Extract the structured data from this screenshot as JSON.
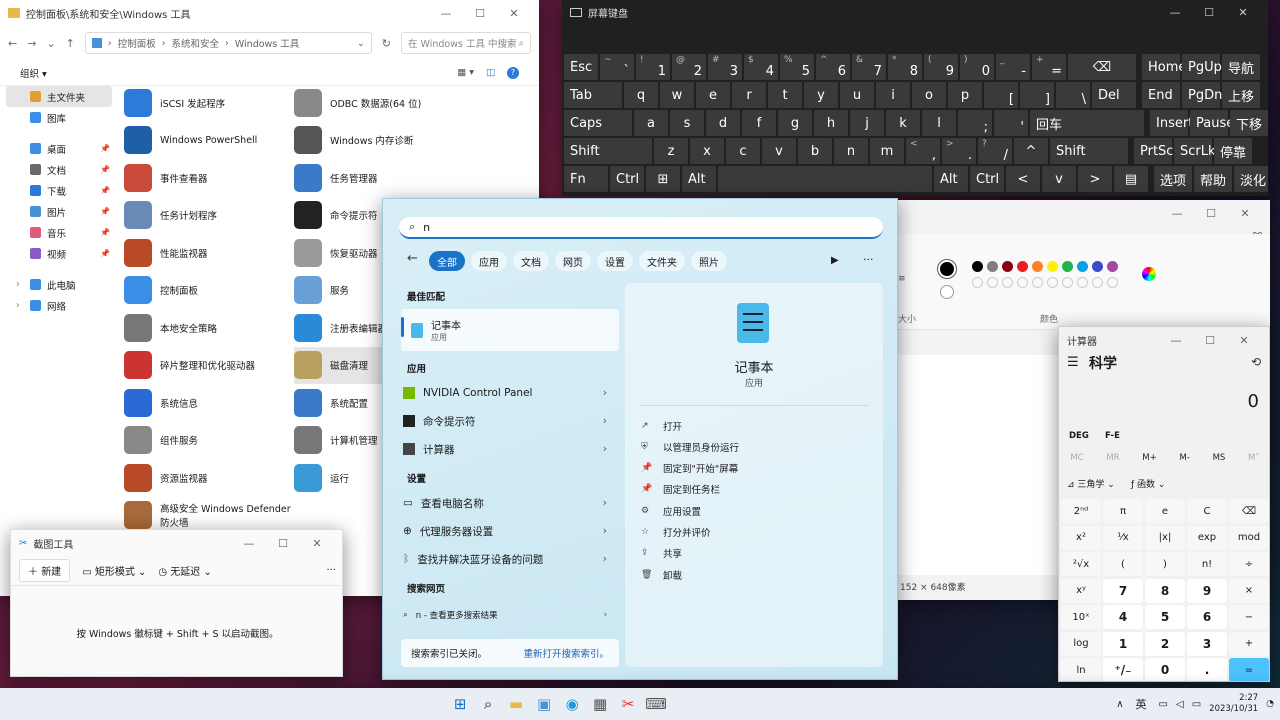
{
  "explorer": {
    "title": "控制面板\\系统和安全\\Windows 工具",
    "breadcrumb": [
      "控制面板",
      "系统和安全",
      "Windows 工具"
    ],
    "search_placeholder": "在 Windows 工具 中搜索",
    "organize": "组织",
    "nav": [
      {
        "label": "主文件夹",
        "pin": false,
        "sel": true,
        "color": "#e0a030"
      },
      {
        "label": "图库",
        "pin": false,
        "color": "#3a8ee6"
      },
      {
        "label": "桌面",
        "pin": true,
        "color": "#3a8ee6"
      },
      {
        "label": "文档",
        "pin": true,
        "color": "#6a6a6a"
      },
      {
        "label": "下载",
        "pin": true,
        "color": "#2a7ad6"
      },
      {
        "label": "图片",
        "pin": true,
        "color": "#4a90d9"
      },
      {
        "label": "音乐",
        "pin": true,
        "color": "#e05a7a"
      },
      {
        "label": "视频",
        "pin": true,
        "color": "#8a5ac8"
      },
      {
        "label": "此电脑",
        "pin": false,
        "color": "#3a8ee6"
      },
      {
        "label": "网络",
        "pin": false,
        "color": "#3a8ee6"
      }
    ],
    "files_left": [
      "iSCSI 发起程序",
      "Windows PowerShell",
      "事件查看器",
      "任务计划程序",
      "性能监视器",
      "控制面板",
      "本地安全策略",
      "碎片整理和优化驱动器",
      "系统信息",
      "组件服务",
      "资源监视器",
      "高级安全 Windows Defender 防火墙"
    ],
    "files_right": [
      "ODBC 数据源(64 位)",
      "Windows 内存诊断",
      "任务管理器",
      "命令提示符",
      "恢复驱动器",
      "服务",
      "注册表编辑器",
      "磁盘清理",
      "系统配置",
      "计算机管理",
      "运行"
    ]
  },
  "osk": {
    "title": "屏幕键盘",
    "rows": [
      [
        [
          "Esc",
          ""
        ],
        [
          "~",
          "`"
        ],
        [
          "!",
          "1"
        ],
        [
          "@",
          "2"
        ],
        [
          "#",
          "3"
        ],
        [
          "$",
          "4"
        ],
        [
          "%",
          "5"
        ],
        [
          "^",
          "6"
        ],
        [
          "&",
          "7"
        ],
        [
          "*",
          "8"
        ],
        [
          "(",
          "9"
        ],
        [
          ")",
          "0"
        ],
        [
          "_",
          "-"
        ],
        [
          "+",
          "="
        ],
        [
          "⌫",
          ""
        ],
        [
          "Home",
          ""
        ],
        [
          "PgUp",
          ""
        ],
        [
          "导航",
          ""
        ]
      ],
      [
        [
          "Tab",
          ""
        ],
        [
          "q",
          ""
        ],
        [
          "w",
          ""
        ],
        [
          "e",
          ""
        ],
        [
          "r",
          ""
        ],
        [
          "t",
          ""
        ],
        [
          "y",
          ""
        ],
        [
          "u",
          ""
        ],
        [
          "i",
          ""
        ],
        [
          "o",
          ""
        ],
        [
          "p",
          ""
        ],
        [
          "",
          "["
        ],
        [
          "",
          "]"
        ],
        [
          "",
          "\\"
        ],
        [
          "Del",
          ""
        ],
        [
          "End",
          ""
        ],
        [
          "PgDn",
          ""
        ],
        [
          "上移",
          ""
        ]
      ],
      [
        [
          "Caps",
          ""
        ],
        [
          "a",
          ""
        ],
        [
          "s",
          ""
        ],
        [
          "d",
          ""
        ],
        [
          "f",
          ""
        ],
        [
          "g",
          ""
        ],
        [
          "h",
          ""
        ],
        [
          "j",
          ""
        ],
        [
          "k",
          ""
        ],
        [
          "l",
          ""
        ],
        [
          "",
          ";"
        ],
        [
          "",
          "'"
        ],
        [
          "回车",
          ""
        ],
        [
          "Insert",
          ""
        ],
        [
          "Pause",
          ""
        ],
        [
          "下移",
          ""
        ]
      ],
      [
        [
          "Shift",
          ""
        ],
        [
          "z",
          ""
        ],
        [
          "x",
          ""
        ],
        [
          "c",
          ""
        ],
        [
          "v",
          ""
        ],
        [
          "b",
          ""
        ],
        [
          "n",
          ""
        ],
        [
          "m",
          ""
        ],
        [
          "<",
          ","
        ],
        [
          ">",
          "."
        ],
        [
          "?",
          "/"
        ],
        [
          "^",
          ""
        ],
        [
          "Shift",
          ""
        ],
        [
          "PrtScn",
          ""
        ],
        [
          "ScrLk",
          ""
        ],
        [
          "停靠",
          ""
        ]
      ],
      [
        [
          "Fn",
          ""
        ],
        [
          "Ctrl",
          ""
        ],
        [
          "⊞",
          ""
        ],
        [
          "Alt",
          ""
        ],
        [
          "",
          ""
        ],
        [
          "Alt",
          ""
        ],
        [
          "Ctrl",
          ""
        ],
        [
          "<",
          ""
        ],
        [
          "v",
          ""
        ],
        [
          ">",
          ""
        ],
        [
          "▤",
          ""
        ],
        [
          "选项",
          ""
        ],
        [
          "帮助",
          ""
        ],
        [
          "淡化",
          ""
        ]
      ]
    ]
  },
  "paint": {
    "size_label": "大小",
    "colors_label": "颜色",
    "canvas_size": "152 × 648像素",
    "colors": [
      "#000000",
      "#7f7f7f",
      "#880015",
      "#ed1c24",
      "#ff7f27",
      "#fff200",
      "#22b14c",
      "#00a2e8",
      "#3f48cc",
      "#a349a4",
      "#ffffff",
      "#c3c3c3",
      "#b97a57",
      "#ffaec9",
      "#ffc90e",
      "#efe4b0",
      "#b5e61d",
      "#99d9ea",
      "#7092be",
      "#c8bfe7"
    ]
  },
  "calc": {
    "title": "计算器",
    "mode": "科学",
    "display": "0",
    "deg": "DEG",
    "fe": "F-E",
    "mem": [
      "MC",
      "MR",
      "M+",
      "M-",
      "MS",
      "M˅"
    ],
    "trig": "三角学",
    "func": "函数",
    "keys": [
      [
        "2ⁿᵈ",
        "π",
        "e",
        "C",
        "⌫"
      ],
      [
        "x²",
        "¹⁄x",
        "|x|",
        "exp",
        "mod"
      ],
      [
        "²√x",
        "(",
        ")",
        "n!",
        "÷"
      ],
      [
        "xʸ",
        "7",
        "8",
        "9",
        "×"
      ],
      [
        "10ˣ",
        "4",
        "5",
        "6",
        "−"
      ],
      [
        "log",
        "1",
        "2",
        "3",
        "+"
      ],
      [
        "ln",
        "⁺/₋",
        "0",
        ".",
        "="
      ]
    ]
  },
  "snip": {
    "title": "截图工具",
    "new": "新建",
    "mode": "矩形模式",
    "delay": "无延迟",
    "hint": "按 Windows 徽标键 + Shift + S 以启动截图。"
  },
  "search": {
    "query": "n",
    "tabs": [
      "全部",
      "应用",
      "文档",
      "网页",
      "设置",
      "文件夹",
      "照片"
    ],
    "best_match_header": "最佳匹配",
    "best_match": {
      "name": "记事本",
      "type": "应用"
    },
    "apps_header": "应用",
    "apps": [
      "NVIDIA Control Panel",
      "命令提示符",
      "计算器"
    ],
    "settings_header": "设置",
    "settings": [
      "查看电脑名称",
      "代理服务器设置",
      "查找并解决蓝牙设备的问题"
    ],
    "web_header": "搜索网页",
    "web_item": "n - 查看更多搜索结果",
    "index_off": "搜索索引已关闭。",
    "reopen_index": "重新打开搜索索引。",
    "detail_name": "记事本",
    "detail_type": "应用",
    "actions": [
      "打开",
      "以管理员身份运行",
      "固定到\"开始\"屏幕",
      "固定到任务栏",
      "应用设置",
      "打分并评价",
      "共享",
      "卸载"
    ]
  },
  "taskbar": {
    "ime": "英",
    "time": "2:27",
    "date": "2023/10/31"
  }
}
